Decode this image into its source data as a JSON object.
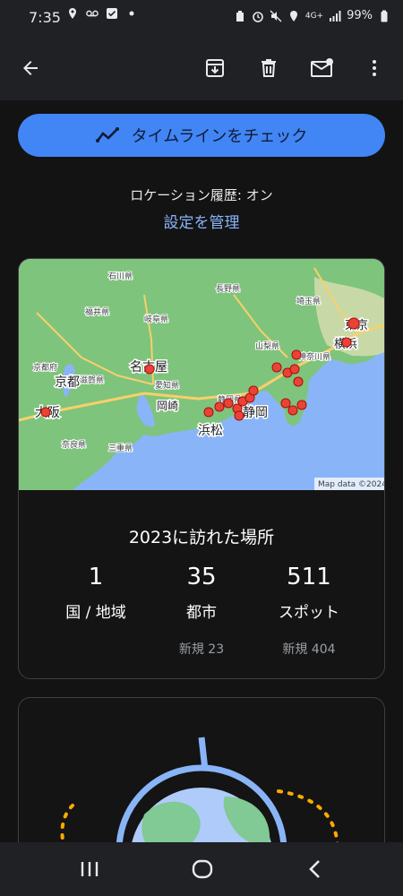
{
  "status_bar": {
    "time": "7:35",
    "network": "4G+",
    "battery": "99%",
    "left_icons": [
      "location-icon",
      "voicemail-icon",
      "checkbox-icon",
      "dot-icon"
    ],
    "right_icons": [
      "data-saver-icon",
      "alarm-icon",
      "mute-icon",
      "location-icon",
      "signal-icon",
      "battery-icon"
    ]
  },
  "app_bar": {
    "icons": [
      "back-arrow-icon",
      "archive-icon",
      "delete-icon",
      "mail-icon",
      "more-vert-icon"
    ]
  },
  "timeline_button": {
    "label": "タイムラインをチェック",
    "icon": "timeline-icon"
  },
  "location_history": {
    "status": "ロケーション履歴: オン",
    "manage_link": "設定を管理"
  },
  "map": {
    "attribution": "Map data ©2024",
    "cities": [
      "東京",
      "横浜",
      "名古屋",
      "京都",
      "大阪",
      "静岡",
      "浜松",
      "岡崎"
    ],
    "prefectures": [
      "石川県",
      "長野県",
      "福井県",
      "岐阜県",
      "埼玉県",
      "山梨県",
      "神奈川県",
      "京都府",
      "滋賀県",
      "愛知県",
      "静岡県",
      "三重県",
      "奈良県"
    ]
  },
  "summary": {
    "title": "2023に訪れた場所",
    "stats": [
      {
        "value": "1",
        "label": "国 / 地域",
        "sub": ""
      },
      {
        "value": "35",
        "label": "都市",
        "sub": "新規 23"
      },
      {
        "value": "511",
        "label": "スポット",
        "sub": "新規 404"
      }
    ]
  },
  "colors": {
    "accent": "#4285f4",
    "link": "#8ab4f8",
    "pin": "#ea4335"
  },
  "nav_bar": {
    "icons": [
      "recents-icon",
      "home-icon",
      "back-icon"
    ]
  }
}
